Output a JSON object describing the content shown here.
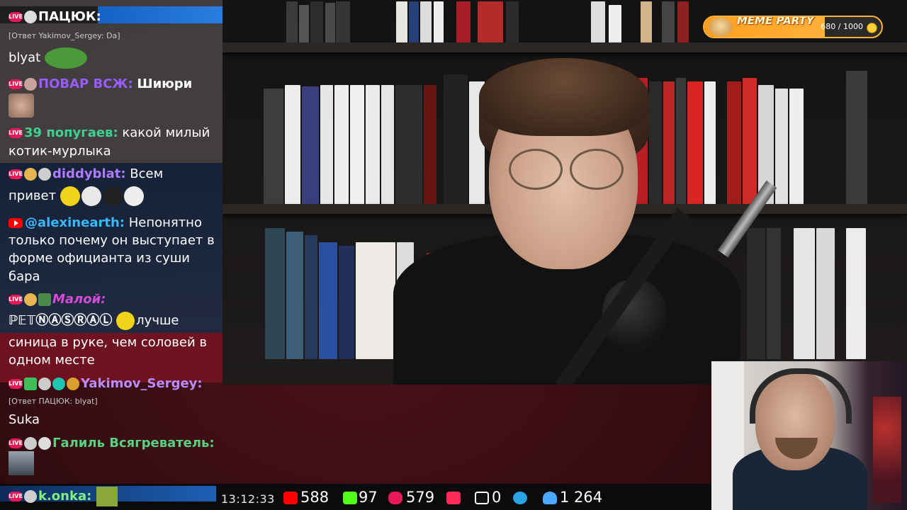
{
  "overlay": {
    "meme_party": {
      "title": "MEME PARTY",
      "progress": "680 / 1000",
      "progress_fraction": 0.68,
      "accent": "#ffb13b"
    }
  },
  "chat": {
    "messages": [
      {
        "platform": "live",
        "author": "ПАЦЮК:",
        "author_color": "#ffffff",
        "reply": "",
        "text": ""
      },
      {
        "platform": "live",
        "author": "",
        "author_color": "",
        "reply": "[Ответ Yakimov_Sergey: Da]",
        "text": "blyat"
      },
      {
        "platform": "live",
        "author": "ПОВАР ВСЖ:",
        "author_color": "#9a5cff",
        "reply": "",
        "text": "Шиюри"
      },
      {
        "platform": "live",
        "author": "39 попугаев:",
        "author_color": "#3fd18b",
        "reply": "",
        "text": "какой милый",
        "text2": "котик-мурлыка"
      },
      {
        "platform": "live",
        "author": "diddyblat:",
        "author_color": "#b07bff",
        "reply": "",
        "text": "Всем",
        "text2": "привет"
      },
      {
        "platform": "youtube",
        "author": "@alexinearth:",
        "author_color": "#38b8ff",
        "reply": "",
        "text": "Непонятно",
        "text2": "только почему он выступает в",
        "text3": "форме официанта из суши",
        "text4": "бара"
      },
      {
        "platform": "live",
        "author": "Малой:",
        "author_color": "#d44bd8",
        "reply": "",
        "text": "ℙ𝔼𝕋ⓃⒶⓈⓇⒶⓁ",
        "text2": "лучше",
        "text3": "синица в руке, чем соловей в",
        "text4": "одном месте"
      },
      {
        "platform": "live",
        "author": "Yakimov_Sergey:",
        "author_color": "#b98cff",
        "reply": "[Ответ ПАЦЮК: blyat]",
        "text": "Suka"
      },
      {
        "platform": "live",
        "author": "Галиль Всягреватель:",
        "author_color": "#5ad17e",
        "reply": "",
        "text": ""
      },
      {
        "platform": "live",
        "author": "k.onka:",
        "author_color": "#7ff07f",
        "reply": "",
        "text": ""
      }
    ]
  },
  "statusbar": {
    "clock": "13:12:33",
    "stats": [
      {
        "icon": "youtube-icon",
        "value": "588",
        "color": "#ff0000"
      },
      {
        "icon": "kick-icon",
        "value": "97",
        "color": "#53fc18"
      },
      {
        "icon": "vklive-icon",
        "value": "579",
        "color": "#e9185b"
      },
      {
        "icon": "twitch-icon",
        "value": "",
        "color": "#ff2a55"
      },
      {
        "icon": "rutube-icon",
        "value": "0",
        "color": "#ffffff"
      },
      {
        "icon": "telegram-icon",
        "value": "",
        "color": "#2aa3e6"
      },
      {
        "icon": "viewers-icon",
        "value": "1 264",
        "color": "#4aa7ff"
      }
    ]
  }
}
